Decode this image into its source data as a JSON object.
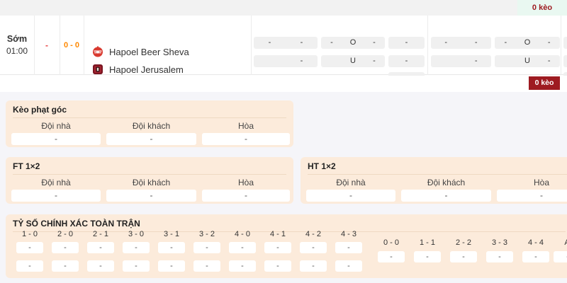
{
  "topbar": {
    "odds_count": "0 kèo"
  },
  "footer_bar": {
    "odds_count_button": "0 kèo"
  },
  "match": {
    "time_label": "Sớm",
    "time": "01:00",
    "status_dash": "-",
    "score": "0 - 0",
    "home_team": "Hapoel Beer Sheva",
    "away_team": "Hapoel Jerusalem"
  },
  "odds_table": {
    "dash": "-",
    "over": "O",
    "under": "U"
  },
  "corner_section": {
    "title": "Kèo phạt góc",
    "headers": [
      "Đội nhà",
      "Đội khách",
      "Hòa"
    ],
    "values": [
      "-",
      "-",
      "-"
    ]
  },
  "ft_section": {
    "title": "FT 1×2",
    "headers": [
      "Đội nhà",
      "Đội khách",
      "Hòa"
    ],
    "values": [
      "-",
      "-",
      "-"
    ]
  },
  "ht_section": {
    "title": "HT 1×2",
    "headers": [
      "Đội nhà",
      "Đội khách",
      "Hòa"
    ],
    "values": [
      "-",
      "-",
      "-"
    ]
  },
  "score_section": {
    "title": "TỶ SỐ CHÍNH XÁC TOÀN TRẬN",
    "categories": [
      "1 - 0",
      "2 - 0",
      "2 - 1",
      "3 - 0",
      "3 - 1",
      "3 - 2",
      "4 - 0",
      "4 - 1",
      "4 - 2",
      "4 - 3"
    ],
    "row1": [
      "-",
      "-",
      "-",
      "-",
      "-",
      "-",
      "-",
      "-",
      "-",
      "-"
    ],
    "row2": [
      "-",
      "-",
      "-",
      "-",
      "-",
      "-",
      "-",
      "-",
      "-",
      "-"
    ],
    "draw_categories": [
      "0 - 0",
      "1 - 1",
      "2 - 2",
      "3 - 3",
      "4 - 4",
      "A"
    ],
    "draw_values": [
      "-",
      "-",
      "-",
      "-",
      "-",
      "-"
    ]
  },
  "colors": {
    "brand_red": "#9e1b21",
    "accent_orange": "#ff8800",
    "dash_red": "#e84444",
    "section_peach": "#fcebdb",
    "mint": "#e9f8f1"
  }
}
